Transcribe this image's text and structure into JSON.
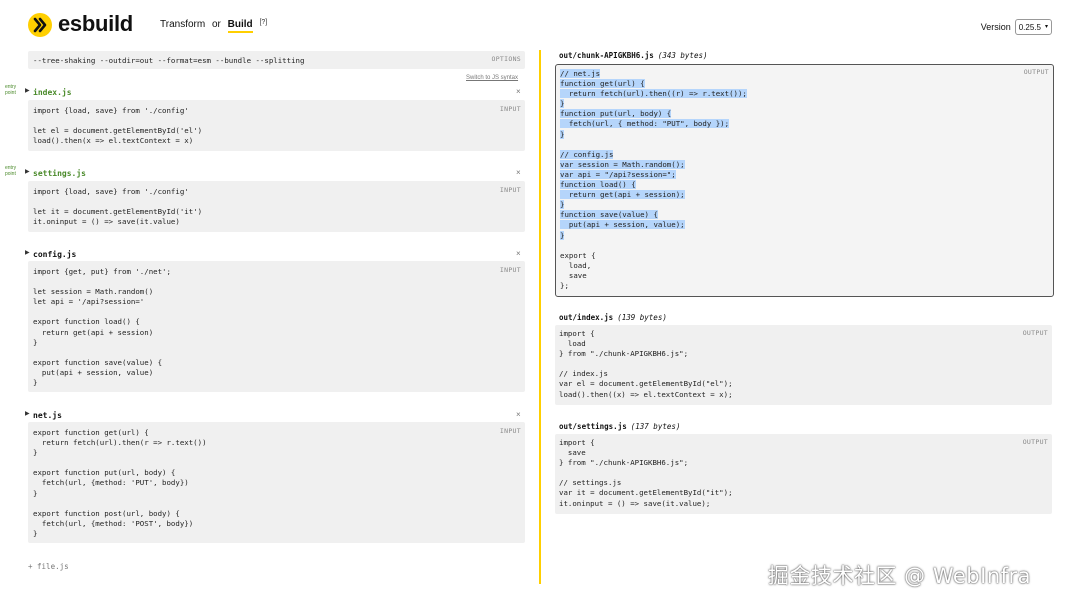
{
  "header": {
    "app_name": "esbuild",
    "logo_icon": "esbuild-chevron-icon",
    "mode_transform": "Transform",
    "mode_or": "or",
    "mode_build": "Build",
    "mode_help": "[?]",
    "version_label": "Version",
    "version_value": "0.25.5"
  },
  "options": {
    "text": "--tree-shaking --outdir=out --format=esm --bundle --splitting",
    "tag": "OPTIONS",
    "switch_link": "Switch to JS syntax"
  },
  "input_files": [
    {
      "entry_label_1": "entry",
      "entry_label_2": "point",
      "name": "index.js",
      "tag": "INPUT",
      "code": "import {load, save} from './config'\n\nlet el = document.getElementById('el')\nload().then(x => el.textContext = x)"
    },
    {
      "entry_label_1": "entry",
      "entry_label_2": "point",
      "name": "settings.js",
      "tag": "INPUT",
      "code": "import {load, save} from './config'\n\nlet it = document.getElementById('it')\nit.oninput = () => save(it.value)"
    },
    {
      "name": "config.js",
      "tag": "INPUT",
      "code": "import {get, put} from './net';\n\nlet session = Math.random()\nlet api = '/api?session='\n\nexport function load() {\n  return get(api + session)\n}\n\nexport function save(value) {\n  put(api + session, value)\n}"
    },
    {
      "name": "net.js",
      "tag": "INPUT",
      "code": "export function get(url) {\n  return fetch(url).then(r => r.text())\n}\n\nexport function put(url, body) {\n  fetch(url, {method: 'PUT', body})\n}\n\nexport function post(url, body) {\n  fetch(url, {method: 'POST', body})\n}"
    }
  ],
  "close_symbol": "×",
  "add_file": "+ file.js",
  "outputs": [
    {
      "name": "out/chunk-APIGKBH6.js",
      "size": "(343 bytes)",
      "tag": "OUTPUT",
      "highlighted_code": "// net.js\nfunction get(url) {\n  return fetch(url).then((r) => r.text());\n}\nfunction put(url, body) {\n  fetch(url, { method: \"PUT\", body });\n}\n\n// config.js\nvar session = Math.random();\nvar api = \"/api?session=\";\nfunction load() {\n  return get(api + session);\n}\nfunction save(value) {\n  put(api + session, value);\n}",
      "code": "\n\nexport {\n  load,\n  save\n};"
    },
    {
      "name": "out/index.js",
      "size": "(139 bytes)",
      "tag": "OUTPUT",
      "code": "import {\n  load\n} from \"./chunk-APIGKBH6.js\";\n\n// index.js\nvar el = document.getElementById(\"el\");\nload().then((x) => el.textContext = x);"
    },
    {
      "name": "out/settings.js",
      "size": "(137 bytes)",
      "tag": "OUTPUT",
      "code": "import {\n  save\n} from \"./chunk-APIGKBH6.js\";\n\n// settings.js\nvar it = document.getElementById(\"it\");\nit.oninput = () => save(it.value);"
    }
  ],
  "watermark": "掘金技术社区 @ WebInfra",
  "colors": {
    "accent": "#ffcf00",
    "entry_green": "#4a8a2a",
    "selection": "#b5d5fb",
    "code_bg": "#f0f0f0"
  }
}
